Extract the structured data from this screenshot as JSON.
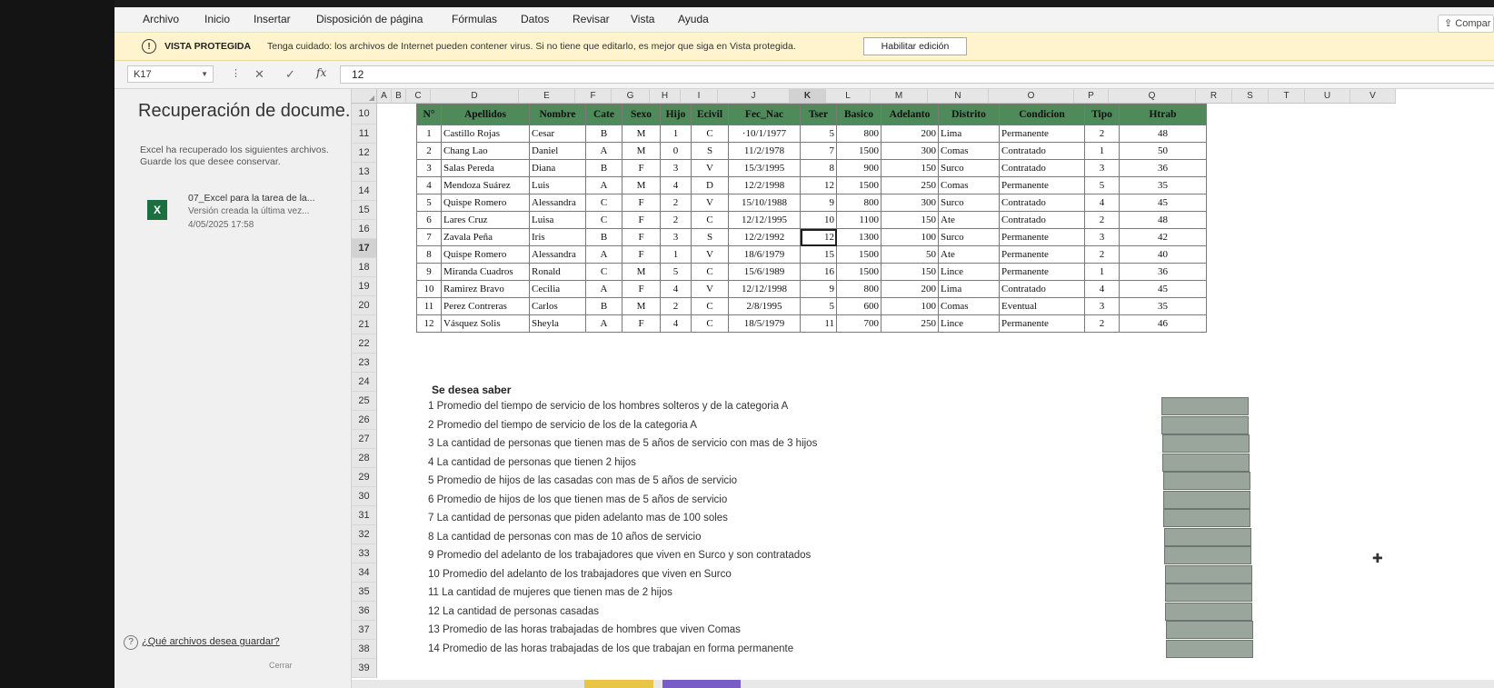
{
  "menu": [
    "Archivo",
    "Inicio",
    "Insertar",
    "Disposición de página",
    "Fórmulas",
    "Datos",
    "Revisar",
    "Vista",
    "Ayuda"
  ],
  "share_label": "Compar",
  "protected": {
    "title": "VISTA PROTEGIDA",
    "message": "Tenga cuidado: los archivos de Internet pueden contener virus. Si no tiene que editarlo, es mejor que siga en Vista protegida.",
    "button": "Habilitar edición"
  },
  "formula_bar": {
    "name_box": "K17",
    "fx": "fx",
    "value": "12"
  },
  "recovery": {
    "title": "Recuperación de docume...",
    "desc1": "Excel ha recuperado los siguientes archivos.",
    "desc2": "Guarde los que desee conservar.",
    "file_name": "07_Excel para la tarea de la...",
    "file_desc": "Versión creada la última vez...",
    "file_date": "4/05/2025 17:58",
    "help": "¿Qué archivos desea guardar?",
    "close": "Cerrar"
  },
  "columns": [
    "A",
    "B",
    "C",
    "D",
    "E",
    "F",
    "G",
    "H",
    "I",
    "J",
    "K",
    "L",
    "M",
    "N",
    "O",
    "P",
    "Q",
    "R",
    "S",
    "T",
    "U",
    "V"
  ],
  "row_numbers": [
    "10",
    "11",
    "12",
    "13",
    "14",
    "15",
    "16",
    "17",
    "18",
    "19",
    "20",
    "21",
    "22",
    "23",
    "24",
    "25",
    "26",
    "27",
    "28",
    "29",
    "30",
    "31",
    "32",
    "33",
    "34",
    "35",
    "36",
    "37",
    "38",
    "39"
  ],
  "table": {
    "headers": [
      "N°",
      "Apellidos",
      "Nombre",
      "Cate",
      "Sexo",
      "Hijo",
      "Ecivil",
      "Fec_Nac",
      "Tser",
      "Basico",
      "Adelanto",
      "Distrito",
      "Condicion",
      "Tipo",
      "Htrab"
    ],
    "rows": [
      [
        "1",
        "Castillo Rojas",
        "Cesar",
        "B",
        "M",
        "1",
        "C",
        "·10/1/1977",
        "5",
        "800",
        "200",
        "Lima",
        "Permanente",
        "2",
        "48"
      ],
      [
        "2",
        "Chang Lao",
        "Daniel",
        "A",
        "M",
        "0",
        "S",
        "11/2/1978",
        "7",
        "1500",
        "300",
        "Comas",
        "Contratado",
        "1",
        "50"
      ],
      [
        "3",
        "Salas Pereda",
        "Diana",
        "B",
        "F",
        "3",
        "V",
        "15/3/1995",
        "8",
        "900",
        "150",
        "Surco",
        "Contratado",
        "3",
        "36"
      ],
      [
        "4",
        "Mendoza Suárez",
        "Luis",
        "A",
        "M",
        "4",
        "D",
        "12/2/1998",
        "12",
        "1500",
        "250",
        "Comas",
        "Permanente",
        "5",
        "35"
      ],
      [
        "5",
        "Quispe Romero",
        "Alessandra",
        "C",
        "F",
        "2",
        "V",
        "15/10/1988",
        "9",
        "800",
        "300",
        "Surco",
        "Contratado",
        "4",
        "45"
      ],
      [
        "6",
        "Lares Cruz",
        "Luisa",
        "C",
        "F",
        "2",
        "C",
        "12/12/1995",
        "10",
        "1100",
        "150",
        "Ate",
        "Contratado",
        "2",
        "48"
      ],
      [
        "7",
        "Zavala Peña",
        "Iris",
        "B",
        "F",
        "3",
        "S",
        "12/2/1992",
        "12",
        "1300",
        "100",
        "Surco",
        "Permanente",
        "3",
        "42"
      ],
      [
        "8",
        "Quispe Romero",
        "Alessandra",
        "A",
        "F",
        "1",
        "V",
        "18/6/1979",
        "15",
        "1500",
        "50",
        "Ate",
        "Permanente",
        "2",
        "40"
      ],
      [
        "9",
        "Miranda Cuadros",
        "Ronald",
        "C",
        "M",
        "5",
        "C",
        "15/6/1989",
        "16",
        "1500",
        "150",
        "Lince",
        "Permanente",
        "1",
        "36"
      ],
      [
        "10",
        "Ramirez Bravo",
        "Cecilia",
        "A",
        "F",
        "4",
        "V",
        "12/12/1998",
        "9",
        "800",
        "200",
        "Lima",
        "Contratado",
        "4",
        "45"
      ],
      [
        "11",
        "Perez Contreras",
        "Carlos",
        "B",
        "M",
        "2",
        "C",
        "2/8/1995",
        "5",
        "600",
        "100",
        "Comas",
        "Eventual",
        "3",
        "35"
      ],
      [
        "12",
        "Vásquez Solis",
        "Sheyla",
        "A",
        "F",
        "4",
        "C",
        "18/5/1979",
        "11",
        "700",
        "250",
        "Lince",
        "Permanente",
        "2",
        "46"
      ]
    ]
  },
  "questions_title": "Se desea saber",
  "questions": [
    "1 Promedio del tiempo de servicio de los hombres solteros y de la categoria A",
    "2 Promedio del tiempo de servicio de los de la categoria A",
    "3 La cantidad de personas que tienen mas de 5 años de servicio con mas de 3 hijos",
    "4 La cantidad de personas que tienen 2 hijos",
    "5 Promedio de hijos de las casadas con mas de 5 años de servicio",
    "6 Promedio de hijos de los que tienen mas de 5 años de servicio",
    "7 La cantidad de personas que piden adelanto mas de 100 soles",
    "8 La cantidad de personas con mas de 10 años de servicio",
    "9 Promedio del adelanto de los trabajadores que viven en Surco y son contratados",
    "10 Promedio del adelanto de los trabajadores que viven en Surco",
    "11 La cantidad de mujeres que tienen mas de 2 hijos",
    "12 La cantidad de personas casadas",
    "13 Promedio de las horas trabajadas de hombres que viven Comas",
    "14 Promedio de las horas trabajadas de los que trabajan en forma permanente"
  ]
}
